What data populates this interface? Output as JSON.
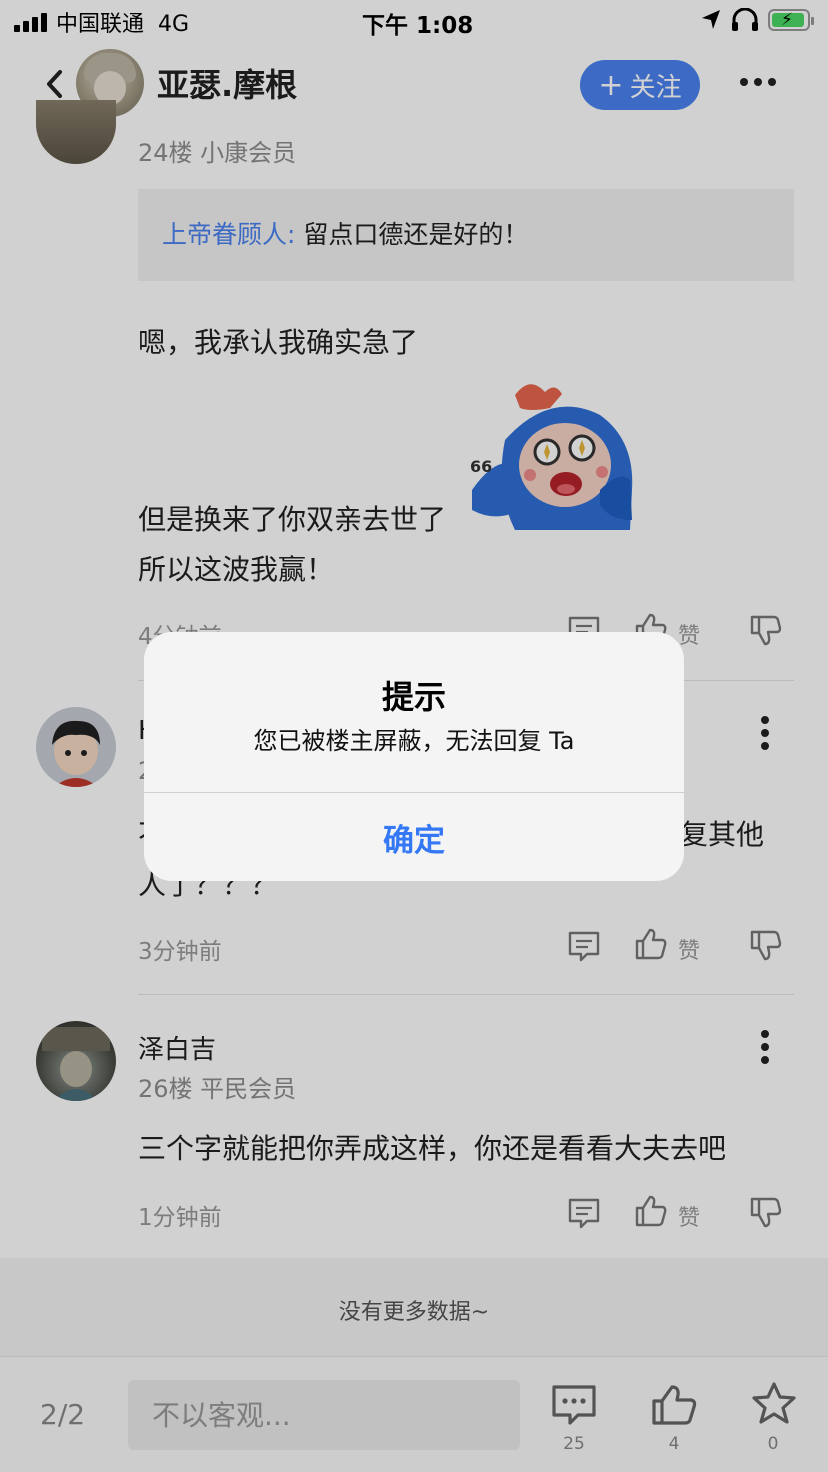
{
  "status_bar": {
    "carrier": "中国联通",
    "network": "4G",
    "time": "下午 1:08",
    "battery_color": "#4cd964"
  },
  "header": {
    "name": "亚瑟.摩根",
    "follow_label": "关注",
    "follow_plus": "+",
    "accent": "#4a82f0"
  },
  "posts": [
    {
      "floor_meta": "24楼  小康会员",
      "quote_user": "上帝眷顾人:",
      "quote_text": "留点口德还是好的！",
      "lines": [
        "嗯，我承认我确实急了",
        "但是换来了你双亲去世了",
        "所以这波我赢！"
      ],
      "sticker_text": "66",
      "time": "4分钟前",
      "like_label": "赞"
    },
    {
      "name": "H",
      "floor_digit": "2",
      "lines_partial": [
        "不",
        "复其他",
        "人了？？？"
      ],
      "time": "3分钟前",
      "like_label": "赞"
    },
    {
      "name": "泽白吉",
      "floor_meta": "26楼  平民会员",
      "lines": [
        "三个字就能把你弄成这样，你还是看看大夫去吧"
      ],
      "time": "1分钟前",
      "like_label": "赞"
    }
  ],
  "no_more": "没有更多数据~",
  "bottom_bar": {
    "page": "2/2",
    "placeholder": "不以客观...",
    "comment_count": "25",
    "like_count": "4",
    "star_count": "0"
  },
  "dialog": {
    "title": "提示",
    "message": "您已被楼主屏蔽，无法回复 Ta",
    "confirm": "确定",
    "button_color": "#3478f6"
  },
  "icons": [
    "signal-icon",
    "location-icon",
    "headphones-icon",
    "battery-icon",
    "back-icon",
    "more-icon",
    "comment-icon",
    "thumbs-up-icon",
    "thumbs-down-icon",
    "vertical-dots-icon",
    "star-icon"
  ]
}
